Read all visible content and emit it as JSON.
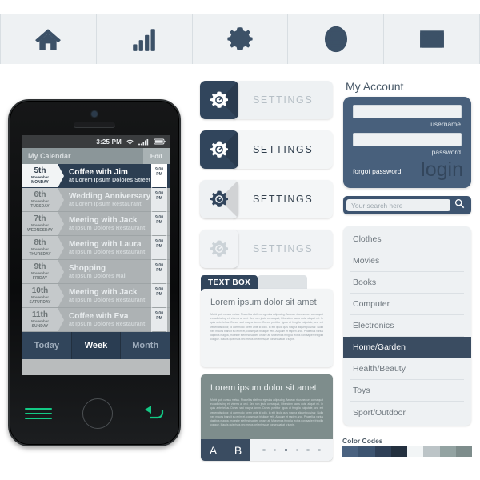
{
  "topnav": {
    "items": [
      {
        "icon": "home-icon",
        "name": "nav-home"
      },
      {
        "icon": "bar-chart-icon",
        "name": "nav-stats"
      },
      {
        "icon": "gear-icon",
        "name": "nav-settings"
      },
      {
        "icon": "globe-icon",
        "name": "nav-globe"
      },
      {
        "icon": "envelope-icon",
        "name": "nav-mail"
      }
    ]
  },
  "phone": {
    "statusbar": {
      "time": "3:25 PM",
      "wifi": "wifi-icon",
      "signal": "signal-icon",
      "battery": "battery-icon"
    },
    "app_header": {
      "title": "My Calendar",
      "edit_label": "Edit"
    },
    "events": [
      {
        "day": "5th",
        "month": "November",
        "weekday": "MONDAY",
        "title": "Coffee with Jim",
        "subtitle": "at Lorem Ipsum Dolores Street",
        "time_h": "9:00",
        "time_m": "PM",
        "active": true
      },
      {
        "day": "6th",
        "month": "November",
        "weekday": "TUESDAY",
        "title": "Wedding Anniversary",
        "subtitle": "at Lorem Ipsum Restaurant",
        "time_h": "9:00",
        "time_m": "PM",
        "active": false
      },
      {
        "day": "7th",
        "month": "November",
        "weekday": "WEDNESDAY",
        "title": "Meeting with Jack",
        "subtitle": "at Ipsum Dolores Restaurant",
        "time_h": "9:00",
        "time_m": "PM",
        "active": false
      },
      {
        "day": "8th",
        "month": "November",
        "weekday": "THURSDAY",
        "title": "Meeting with Laura",
        "subtitle": "at Ipsum Dolores Restaurant",
        "time_h": "9:00",
        "time_m": "PM",
        "active": false
      },
      {
        "day": "9th",
        "month": "November",
        "weekday": "FRIDAY",
        "title": "Shopping",
        "subtitle": "at Ipsum Dolores Mall",
        "time_h": "9:00",
        "time_m": "PM",
        "active": false
      },
      {
        "day": "10th",
        "month": "November",
        "weekday": "SATURDAY",
        "title": "Meeting with Jack",
        "subtitle": "at Ipsum Dolores Restaurant",
        "time_h": "9:00",
        "time_m": "PM",
        "active": false
      },
      {
        "day": "11th",
        "month": "November",
        "weekday": "SUNDAY",
        "title": "Coffee with Eva",
        "subtitle": "at Ipsum Dolores Restaurant",
        "time_h": "9:00",
        "time_m": "PM",
        "active": false
      }
    ],
    "view_tabs": [
      {
        "label": "Today",
        "selected": false
      },
      {
        "label": "Week",
        "selected": true
      },
      {
        "label": "Month",
        "selected": false
      }
    ],
    "hardware": {
      "menu": "menu-icon",
      "home": "home-button",
      "back": "back-arrow-icon",
      "accent": "#13c985"
    }
  },
  "settings_buttons": [
    {
      "label": "SETTINGS",
      "state": "dark-icon-pale-label"
    },
    {
      "label": "SETTINGS",
      "state": "dark-icon-dark-label"
    },
    {
      "label": "SETTINGS",
      "state": "light-icon-dark-label"
    },
    {
      "label": "SETTINGS",
      "state": "disabled"
    }
  ],
  "text_panel": {
    "tab_label": "TEXT BOX",
    "heading": "Lorem ipsum dolor sit amet",
    "body": "Morbi quis cursus metus. Phasellus eleifend egestas adipiscing. Aenean risus neque, consequat eu adipiscing et, viverra at orci. Sed non justo consequat, bibendum lacus quis, aliquet mi. In quis ante tellus. Donec sed magna lorem. Donec porttitor ligula ut fringilla vulputate, orci est venenatis dolor, id commodo lorem ante id odio. In elit ligula quis magna aliquet pulvinar. Nulla nec mauris blandit eu enim et, consequat tristique velit. Aliquam et sapien arcu. Phasellus varius dapibus magna, molestie eleifend sapien ornare at. Maecenas fringilla lectus non sapien fringilla congue. Mauris quis risus nec metus pellentesque consequat at a turpis."
  },
  "gray_panel": {
    "heading": "Lorem ipsum dolor sit amet",
    "body": "Morbi quis cursus metus. Phasellus eleifend egestas adipiscing. Aenean risus neque, consequat eu adipiscing et, viverra at orci. Sed non justo consequat, bibendum lacus quis, aliquet mi. In quis ante tellus. Donec sed magna lorem. Donec porttitor ligula ut fringilla vulputate, orci est venenatis dolor, id commodo lorem ante id odio. In elit ligula quis magna aliquet pulvinar. Nulla nec mauris blandit eu enim et, consequat tristique velit. Aliquam et sapien arcu. Phasellus varius dapibus magna, molestie eleifend sapien ornare at. Maecenas fringilla lectus non sapien fringilla congue. Mauris quis risus nec metus pellentesque consequat at a turpis.",
    "button_a": "A",
    "button_b": "B",
    "dots_total": 6,
    "dot_active_index": 2
  },
  "account": {
    "title": "My Account",
    "username_label": "username",
    "username_value": "",
    "password_label": "password",
    "password_value": "",
    "forgot_label": "forgot password",
    "login_label": "login"
  },
  "search": {
    "placeholder": "Your search here",
    "value": "",
    "icon": "search-icon"
  },
  "categories": [
    {
      "label": "Clothes",
      "selected": false
    },
    {
      "label": "Movies",
      "selected": false
    },
    {
      "label": "Books",
      "selected": false
    },
    {
      "label": "Computer",
      "selected": false
    },
    {
      "label": "Electronics",
      "selected": false
    },
    {
      "label": "Home/Garden",
      "selected": true
    },
    {
      "label": "Health/Beauty",
      "selected": false
    },
    {
      "label": "Toys",
      "selected": false
    },
    {
      "label": "Sport/Outdoor",
      "selected": false
    }
  ],
  "color_codes": {
    "title": "Color Codes",
    "swatches": [
      "#4a6280",
      "#3d5470",
      "#2f4057",
      "#23303f",
      "#f2f5f6",
      "#bcc4c7",
      "#93a3a2",
      "#7e8d8c"
    ]
  }
}
